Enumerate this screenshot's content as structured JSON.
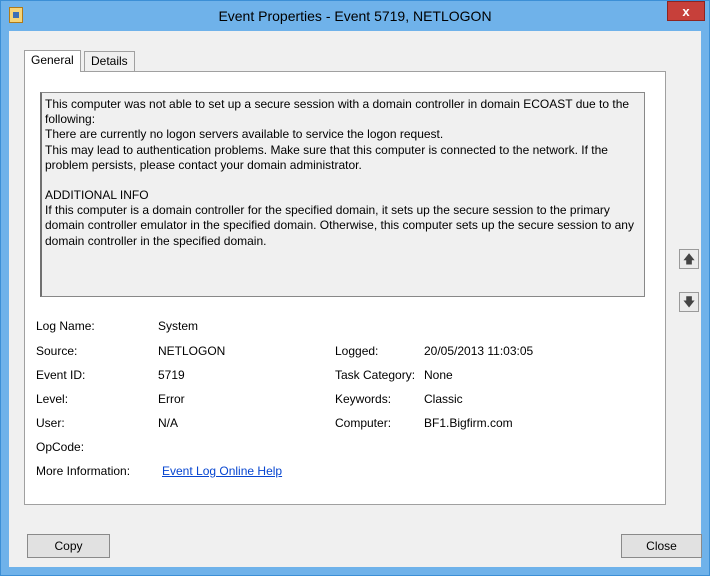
{
  "window": {
    "title": "Event Properties - Event 5719, NETLOGON",
    "close_glyph": "x"
  },
  "tabs": [
    {
      "label": "General",
      "active": true
    },
    {
      "label": "Details",
      "active": false
    }
  ],
  "description": {
    "paragraph1": "This computer was not able to set up a secure session with a domain controller in domain ECOAST due to the following:\nThere are currently no logon servers available to service the logon request.\nThis may lead to authentication problems. Make sure that this computer is connected to the network. If the problem persists, please contact your domain administrator.",
    "paragraph2": "ADDITIONAL INFO\nIf this computer is a domain controller for the specified domain, it sets up the secure session to the primary domain controller emulator in the specified domain. Otherwise, this computer sets up the secure session to any domain controller in the specified domain."
  },
  "fields": {
    "log_name": {
      "label": "Log Name:",
      "value": "System"
    },
    "source": {
      "label": "Source:",
      "value": "NETLOGON"
    },
    "event_id": {
      "label": "Event ID:",
      "value": "5719"
    },
    "level": {
      "label": "Level:",
      "value": "Error"
    },
    "user": {
      "label": "User:",
      "value": "N/A"
    },
    "opcode": {
      "label": "OpCode:",
      "value": ""
    },
    "more_info": {
      "label": "More Information:",
      "link": "Event Log Online Help"
    },
    "logged": {
      "label": "Logged:",
      "value": "20/05/2013 11:03:05"
    },
    "task_category": {
      "label": "Task Category:",
      "value": "None"
    },
    "keywords": {
      "label": "Keywords:",
      "value": "Classic"
    },
    "computer": {
      "label": "Computer:",
      "value": "BF1.Bigfirm.com"
    }
  },
  "nav": {
    "up_icon": "arrow-up-icon",
    "down_icon": "arrow-down-icon"
  },
  "buttons": {
    "copy": "Copy",
    "close": "Close"
  }
}
